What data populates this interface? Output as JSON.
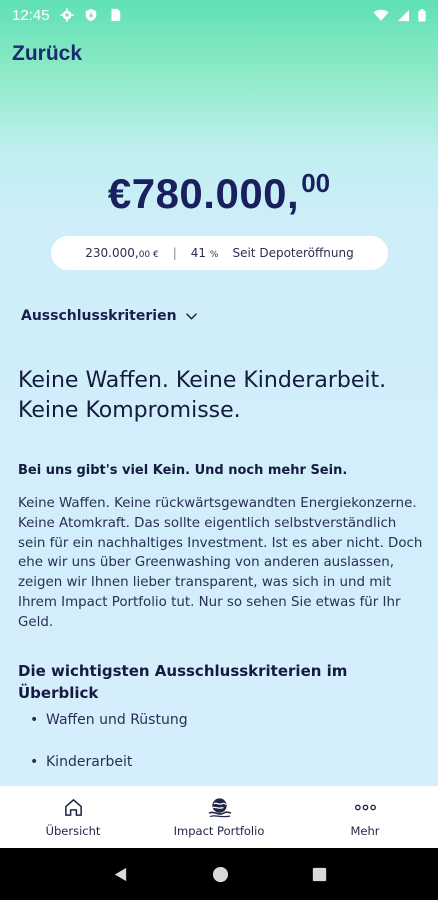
{
  "status_bar": {
    "time": "12:45",
    "icons_left": [
      "gear-icon",
      "shield-icon",
      "sim-card-icon"
    ],
    "icons_right": [
      "wifi-icon",
      "signal-icon",
      "battery-icon"
    ]
  },
  "header": {
    "back_label": "Zurück"
  },
  "balance": {
    "main": "€780.000,",
    "cents": "00"
  },
  "performance": {
    "gain": "230.000,",
    "gain_cents": "00 €",
    "separator": "|",
    "percent": "41",
    "percent_sign": "%",
    "since": "Seit Depoteröffnung"
  },
  "criteria_dropdown": {
    "label": "Ausschlusskriterien"
  },
  "content": {
    "headline_line1": "Keine Waffen. Keine Kinderarbeit.",
    "headline_line2": "Keine Kompromisse.",
    "subhead": "Bei uns gibt's viel Kein. Und noch mehr Sein.",
    "body": "Keine Waffen. Keine rückwärtsgewandten Energiekonzerne. Keine Atomkraft. Das sollte eigentlich selbstverständlich sein für ein nachhaltiges Investment. Ist es aber nicht. Doch ehe wir uns über Greenwashing von anderen auslassen, zeigen wir Ihnen lieber transparent, was sich in und mit Ihrem Impact Portfolio tut. Nur so sehen Sie etwas für Ihr Geld.",
    "section_title": "Die wichtigsten Ausschlusskriterien im Überblick",
    "bullets": [
      "Waffen und Rüstung",
      "Kinderarbeit"
    ]
  },
  "tabbar": {
    "tabs": [
      {
        "label": "Übersicht",
        "icon": "home-icon"
      },
      {
        "label": "Impact Portfolio",
        "icon": "impact-globe-icon"
      },
      {
        "label": "Mehr",
        "icon": "more-dots-icon"
      }
    ]
  },
  "system_nav": {
    "icons": [
      "back-triangle-icon",
      "home-circle-icon",
      "recents-square-icon"
    ]
  }
}
